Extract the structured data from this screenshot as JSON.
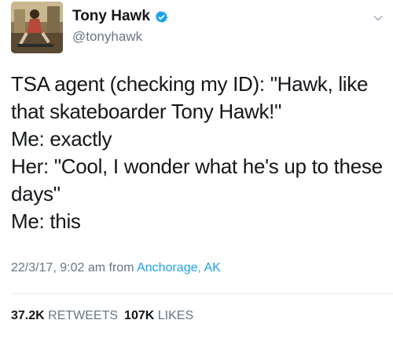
{
  "header": {
    "display_name": "Tony Hawk",
    "handle": "@tonyhawk",
    "verified_icon": "verified-badge-icon",
    "menu_icon": "chevron-down-icon"
  },
  "tweet": {
    "text": "TSA agent (checking my ID): \"Hawk, like that skateboarder Tony Hawk!\"\nMe: exactly\nHer: \"Cool, I wonder what he's up to these days\"\nMe: this",
    "timestamp": "22/3/17, 9:02 am from ",
    "location": "Anchorage, AK"
  },
  "stats": {
    "retweets_count": "37.2K",
    "retweets_label": "RETWEETS",
    "likes_count": "107K",
    "likes_label": "LIKES"
  },
  "colors": {
    "link": "#1da1f2",
    "secondary_text": "#657786",
    "primary_text": "#14171a"
  }
}
